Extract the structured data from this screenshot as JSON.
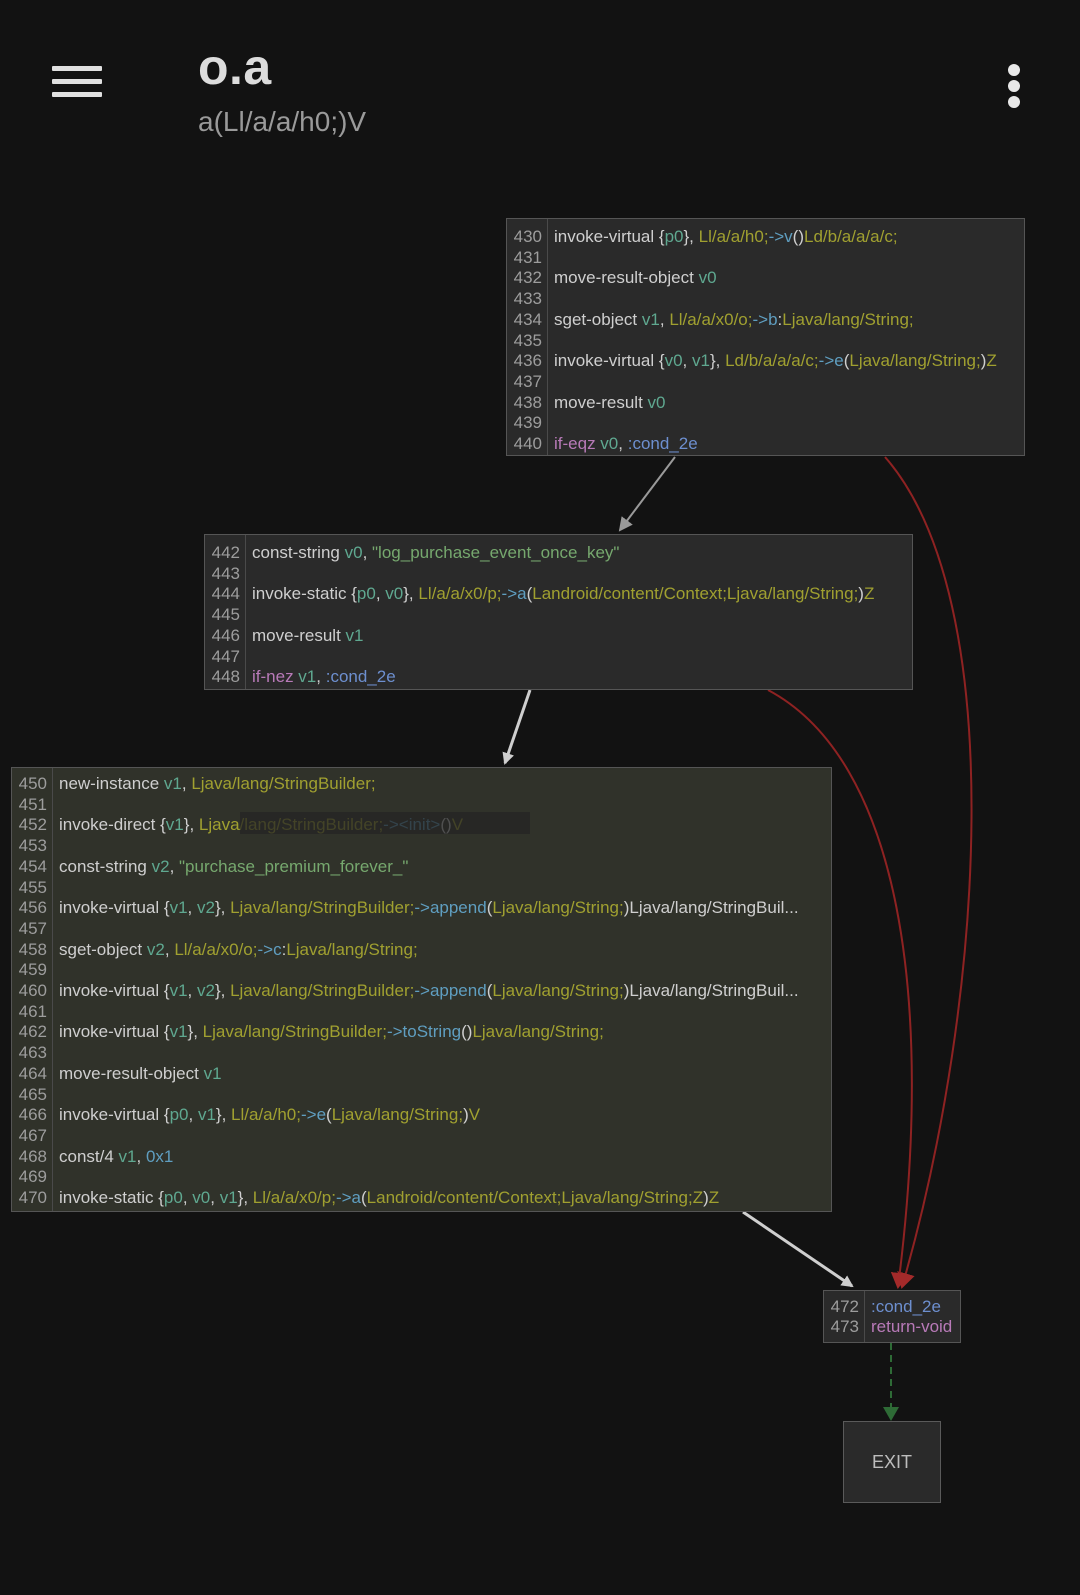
{
  "appbar": {
    "title": "o.a",
    "subtitle": "a(Ll/a/a/h0;)V",
    "menu_icon": "hamburger-menu-icon",
    "more_icon": "more-vertical-icon"
  },
  "colors": {
    "background": "#121212",
    "block_bg": "#2a2a2a",
    "conditional_edge": "#8e2222",
    "flow_edge": "#cccccc",
    "exit_edge": "#2e6b36"
  },
  "blocks": [
    {
      "lines": [
        {
          "n": "430",
          "t": [
            [
              "invoke-virtual ",
              "op"
            ],
            [
              "{",
              "p"
            ],
            [
              "p0",
              "reg"
            ],
            [
              "}, ",
              "p"
            ],
            [
              "Ll/a/a/h0;",
              "typ"
            ],
            [
              "->v",
              "met"
            ],
            [
              "()",
              "p"
            ],
            [
              "Ld/b/a/a/a/c;",
              "typ"
            ]
          ]
        },
        {
          "n": "431",
          "t": []
        },
        {
          "n": "432",
          "t": [
            [
              "move-result-object ",
              "op"
            ],
            [
              "v0",
              "reg"
            ]
          ]
        },
        {
          "n": "433",
          "t": []
        },
        {
          "n": "434",
          "t": [
            [
              "sget-object ",
              "op"
            ],
            [
              "v1",
              "reg"
            ],
            [
              ", ",
              "p"
            ],
            [
              "Ll/a/a/x0/o;",
              "typ"
            ],
            [
              "->b",
              "met"
            ],
            [
              ":",
              "p"
            ],
            [
              "Ljava/lang/String;",
              "typ"
            ]
          ]
        },
        {
          "n": "435",
          "t": []
        },
        {
          "n": "436",
          "t": [
            [
              "invoke-virtual ",
              "op"
            ],
            [
              "{",
              "p"
            ],
            [
              "v0",
              "reg"
            ],
            [
              ", ",
              "p"
            ],
            [
              "v1",
              "reg"
            ],
            [
              "}, ",
              "p"
            ],
            [
              "Ld/b/a/a/a/c;",
              "typ"
            ],
            [
              "->e",
              "met"
            ],
            [
              "(",
              "p"
            ],
            [
              "Ljava/lang/String;",
              "typ"
            ],
            [
              ")",
              "p"
            ],
            [
              "Z",
              "typ"
            ]
          ]
        },
        {
          "n": "437",
          "t": []
        },
        {
          "n": "438",
          "t": [
            [
              "move-result ",
              "op"
            ],
            [
              "v0",
              "reg"
            ]
          ]
        },
        {
          "n": "439",
          "t": []
        },
        {
          "n": "440",
          "t": [
            [
              "if-eqz ",
              "kw"
            ],
            [
              "v0",
              "reg"
            ],
            [
              ", ",
              "p"
            ],
            [
              ":cond_2e",
              "lbl"
            ]
          ]
        }
      ]
    },
    {
      "lines": [
        {
          "n": "442",
          "t": [
            [
              "const-string ",
              "op"
            ],
            [
              "v0",
              "reg"
            ],
            [
              ", ",
              "p"
            ],
            [
              "\"log_purchase_event_once_key\"",
              "str"
            ]
          ]
        },
        {
          "n": "443",
          "t": []
        },
        {
          "n": "444",
          "t": [
            [
              "invoke-static ",
              "op"
            ],
            [
              "{",
              "p"
            ],
            [
              "p0",
              "reg"
            ],
            [
              ", ",
              "p"
            ],
            [
              "v0",
              "reg"
            ],
            [
              "}, ",
              "p"
            ],
            [
              "Ll/a/a/x0/p;",
              "typ"
            ],
            [
              "->a",
              "met"
            ],
            [
              "(",
              "p"
            ],
            [
              "Landroid/content/Context;Ljava/lang/String;",
              "typ"
            ],
            [
              ")",
              "p"
            ],
            [
              "Z",
              "typ"
            ]
          ]
        },
        {
          "n": "445",
          "t": []
        },
        {
          "n": "446",
          "t": [
            [
              "move-result ",
              "op"
            ],
            [
              "v1",
              "reg"
            ]
          ]
        },
        {
          "n": "447",
          "t": []
        },
        {
          "n": "448",
          "t": [
            [
              "if-nez ",
              "kw"
            ],
            [
              "v1",
              "reg"
            ],
            [
              ", ",
              "p"
            ],
            [
              ":cond_2e",
              "lbl"
            ]
          ]
        }
      ]
    },
    {
      "lines": [
        {
          "n": "450",
          "t": [
            [
              "new-instance ",
              "op"
            ],
            [
              "v1",
              "reg"
            ],
            [
              ", ",
              "p"
            ],
            [
              "Ljava/lang/StringBuilder;",
              "typ"
            ]
          ]
        },
        {
          "n": "451",
          "t": []
        },
        {
          "n": "452",
          "t": [
            [
              "invoke-direct ",
              "op"
            ],
            [
              "{",
              "p"
            ],
            [
              "v1",
              "reg"
            ],
            [
              "}, ",
              "p"
            ],
            [
              "Ljava/lang/StringBuilder;",
              "typ"
            ],
            [
              "-><init>",
              "met"
            ],
            [
              "()",
              "p"
            ],
            [
              "V",
              "typ"
            ]
          ]
        },
        {
          "n": "453",
          "t": []
        },
        {
          "n": "454",
          "t": [
            [
              "const-string ",
              "op"
            ],
            [
              "v2",
              "reg"
            ],
            [
              ", ",
              "p"
            ],
            [
              "\"purchase_premium_forever_\"",
              "str"
            ]
          ]
        },
        {
          "n": "455",
          "t": []
        },
        {
          "n": "456",
          "t": [
            [
              "invoke-virtual ",
              "op"
            ],
            [
              "{",
              "p"
            ],
            [
              "v1",
              "reg"
            ],
            [
              ", ",
              "p"
            ],
            [
              "v2",
              "reg"
            ],
            [
              "}, ",
              "p"
            ],
            [
              "Ljava/lang/StringBuilder;",
              "typ"
            ],
            [
              "->append",
              "met"
            ],
            [
              "(",
              "p"
            ],
            [
              "Ljava/lang/String;",
              "typ"
            ],
            [
              ")Ljava/lang/StringBuil...",
              "p"
            ]
          ]
        },
        {
          "n": "457",
          "t": []
        },
        {
          "n": "458",
          "t": [
            [
              "sget-object ",
              "op"
            ],
            [
              "v2",
              "reg"
            ],
            [
              ", ",
              "p"
            ],
            [
              "Ll/a/a/x0/o;",
              "typ"
            ],
            [
              "->c",
              "met"
            ],
            [
              ":",
              "p"
            ],
            [
              "Ljava/lang/String;",
              "typ"
            ]
          ]
        },
        {
          "n": "459",
          "t": []
        },
        {
          "n": "460",
          "t": [
            [
              "invoke-virtual ",
              "op"
            ],
            [
              "{",
              "p"
            ],
            [
              "v1",
              "reg"
            ],
            [
              ", ",
              "p"
            ],
            [
              "v2",
              "reg"
            ],
            [
              "}, ",
              "p"
            ],
            [
              "Ljava/lang/StringBuilder;",
              "typ"
            ],
            [
              "->append",
              "met"
            ],
            [
              "(",
              "p"
            ],
            [
              "Ljava/lang/String;",
              "typ"
            ],
            [
              ")Ljava/lang/StringBuil...",
              "p"
            ]
          ]
        },
        {
          "n": "461",
          "t": []
        },
        {
          "n": "462",
          "t": [
            [
              "invoke-virtual ",
              "op"
            ],
            [
              "{",
              "p"
            ],
            [
              "v1",
              "reg"
            ],
            [
              "}, ",
              "p"
            ],
            [
              "Ljava/lang/StringBuilder;",
              "typ"
            ],
            [
              "->toString",
              "met"
            ],
            [
              "()",
              "p"
            ],
            [
              "Ljava/lang/String;",
              "typ"
            ]
          ]
        },
        {
          "n": "463",
          "t": []
        },
        {
          "n": "464",
          "t": [
            [
              "move-result-object ",
              "op"
            ],
            [
              "v1",
              "reg"
            ]
          ]
        },
        {
          "n": "465",
          "t": []
        },
        {
          "n": "466",
          "t": [
            [
              "invoke-virtual ",
              "op"
            ],
            [
              "{",
              "p"
            ],
            [
              "p0",
              "reg"
            ],
            [
              ", ",
              "p"
            ],
            [
              "v1",
              "reg"
            ],
            [
              "}, ",
              "p"
            ],
            [
              "Ll/a/a/h0;",
              "typ"
            ],
            [
              "->e",
              "met"
            ],
            [
              "(",
              "p"
            ],
            [
              "Ljava/lang/String;",
              "typ"
            ],
            [
              ")",
              "p"
            ],
            [
              "V",
              "typ"
            ]
          ]
        },
        {
          "n": "467",
          "t": []
        },
        {
          "n": "468",
          "t": [
            [
              "const/4 ",
              "op"
            ],
            [
              "v1",
              "reg"
            ],
            [
              ", ",
              "p"
            ],
            [
              "0x1",
              "met"
            ]
          ]
        },
        {
          "n": "469",
          "t": []
        },
        {
          "n": "470",
          "t": [
            [
              "invoke-static ",
              "op"
            ],
            [
              "{",
              "p"
            ],
            [
              "p0",
              "reg"
            ],
            [
              ", ",
              "p"
            ],
            [
              "v0",
              "reg"
            ],
            [
              ", ",
              "p"
            ],
            [
              "v1",
              "reg"
            ],
            [
              "}, ",
              "p"
            ],
            [
              "Ll/a/a/x0/p;",
              "typ"
            ],
            [
              "->a",
              "met"
            ],
            [
              "(",
              "p"
            ],
            [
              "Landroid/content/Context;Ljava/lang/String;Z",
              "typ"
            ],
            [
              ")",
              "p"
            ],
            [
              "Z",
              "typ"
            ]
          ]
        }
      ]
    },
    {
      "lines": [
        {
          "n": "472",
          "t": [
            [
              ":cond_2e",
              "lbl"
            ]
          ]
        },
        {
          "n": "473",
          "t": [
            [
              "return-void",
              "kw"
            ]
          ]
        }
      ]
    }
  ],
  "exit_label": "EXIT"
}
